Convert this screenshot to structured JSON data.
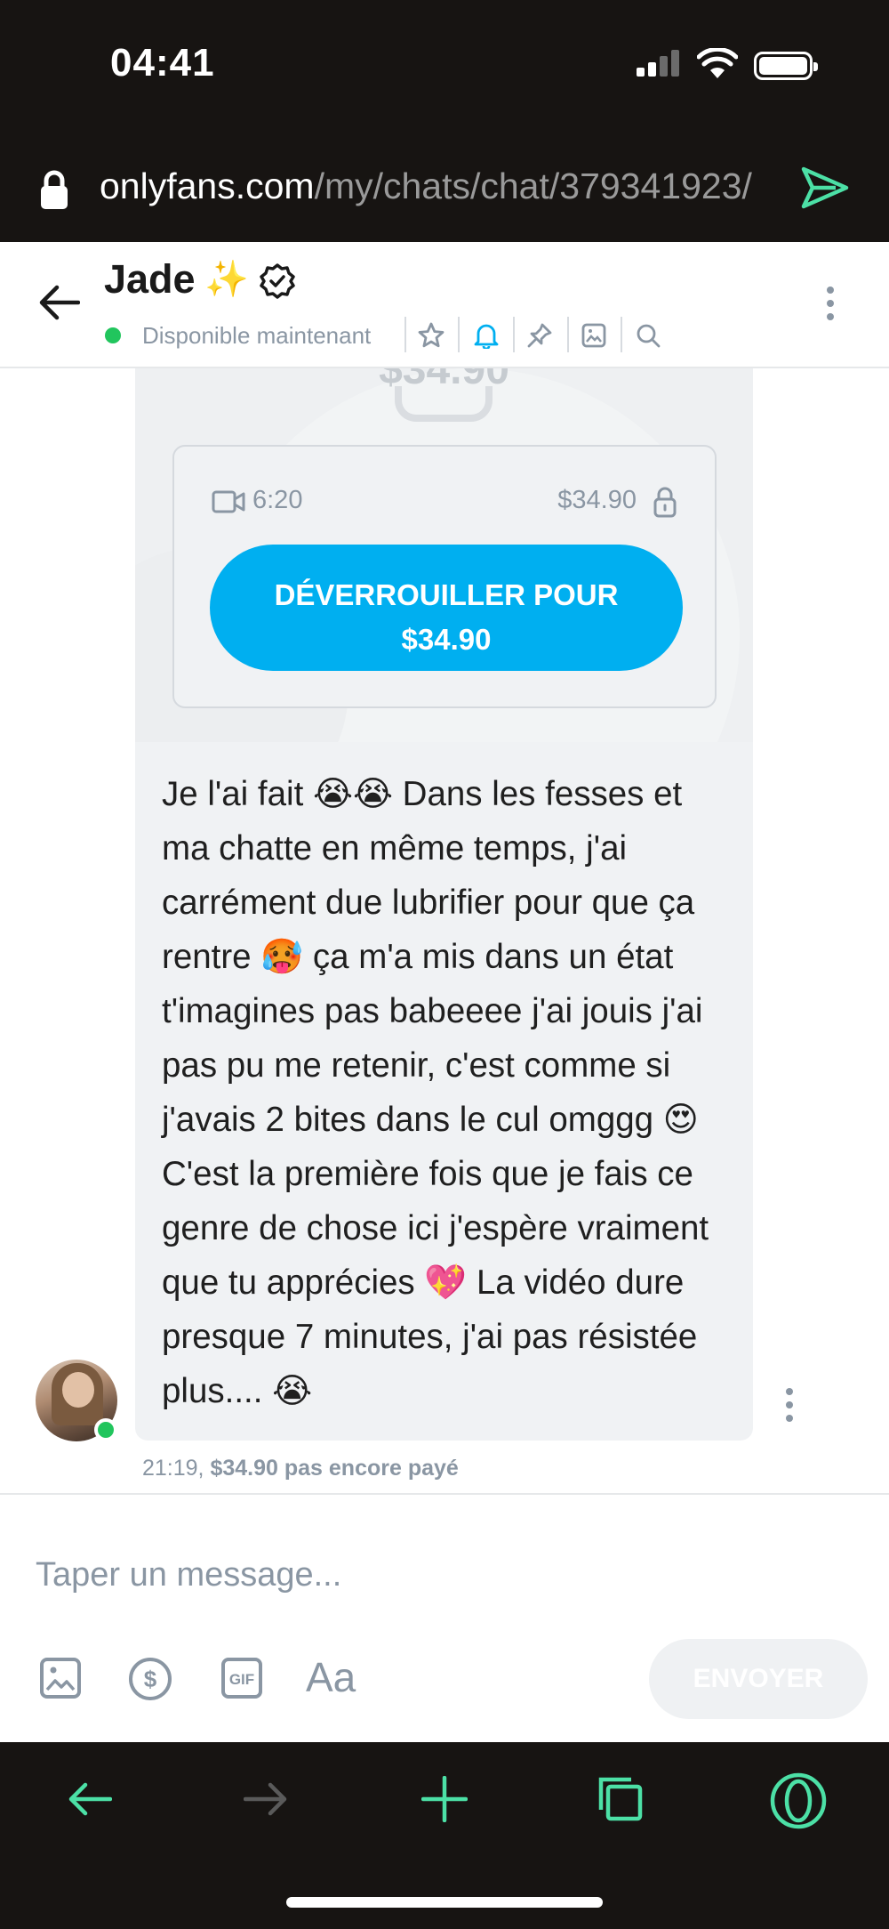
{
  "status_bar": {
    "time": "04:41"
  },
  "browser": {
    "url_host": "onlyfans.com",
    "url_path": "/my/chats/chat/379341923/"
  },
  "chat_header": {
    "name": "Jade",
    "name_emoji": "✨",
    "status": "Disponible maintenant",
    "accent_color": "#00aff0",
    "online_color": "#21c55d"
  },
  "message": {
    "ghost_price": "$34.90",
    "video_duration": "6:20",
    "price": "$34.90",
    "unlock_line1": "DÉVERROUILLER POUR",
    "unlock_line2": "$34.90",
    "text": "Je l'ai fait 😭😭 Dans les fesses et ma chatte en même temps, j'ai carrément due lubrifier pour que ça rentre 🥵 ça m'a mis dans un état t'imagines pas babeeee j'ai jouis j'ai pas pu me retenir, c'est comme si j'avais 2 bites dans le cul omggg 😍 C'est la première fois que je fais ce genre de chose ici j'espère vraiment que tu apprécies 💖 La vidéo dure presque 7 minutes, j'ai pas résistée plus.... 😭",
    "time": "21:19,",
    "payment_status": "$34.90 pas encore payé"
  },
  "composer": {
    "placeholder": "Taper un message...",
    "font_label": "Aa",
    "send_label": "ENVOYER"
  },
  "icons": {
    "header": [
      "star-icon",
      "bell-icon",
      "pin-icon",
      "image-icon",
      "search-icon"
    ],
    "composer": [
      "image-icon",
      "dollar-icon",
      "gif-icon"
    ],
    "browser_bottom": [
      "back-icon",
      "forward-icon",
      "plus-icon",
      "tabs-icon",
      "opera-icon"
    ]
  }
}
